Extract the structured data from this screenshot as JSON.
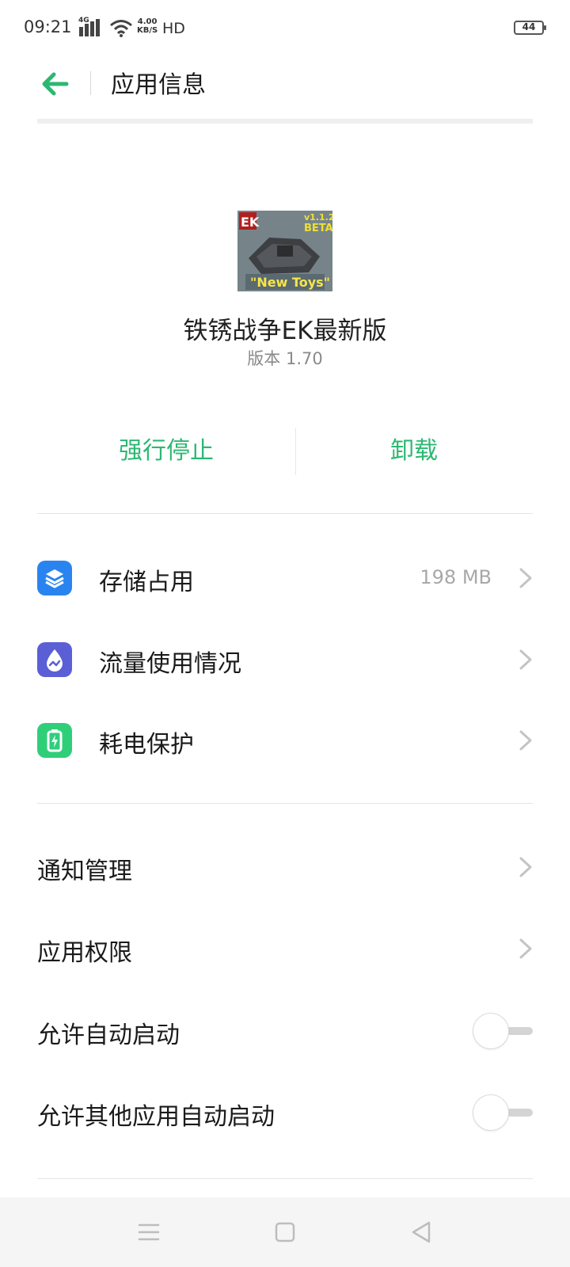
{
  "status_bar": {
    "time": "09:21",
    "network": "4G",
    "speed_value": "4.00",
    "speed_unit": "KB/S",
    "hd": "HD",
    "battery": "44"
  },
  "header": {
    "title": "应用信息",
    "accent_color": "#2cb872"
  },
  "app": {
    "icon_name": "app-icon",
    "name": "铁锈战争EK最新版",
    "version": "版本 1.70"
  },
  "actions": {
    "force_stop": "强行停止",
    "uninstall": "卸载"
  },
  "items": [
    {
      "icon": "layers-icon",
      "color": "#2a84f0",
      "label": "存储占用",
      "value": "198 MB"
    },
    {
      "icon": "data-usage-icon",
      "color": "#5a5fd6",
      "label": "流量使用情况",
      "value": ""
    },
    {
      "icon": "battery-icon",
      "color": "#2fcf7a",
      "label": "耗电保护",
      "value": ""
    }
  ],
  "settings": [
    {
      "label": "通知管理"
    },
    {
      "label": "应用权限"
    },
    {
      "label": "允许自动启动",
      "toggle": false
    },
    {
      "label": "允许其他应用自动启动",
      "toggle": false
    }
  ]
}
